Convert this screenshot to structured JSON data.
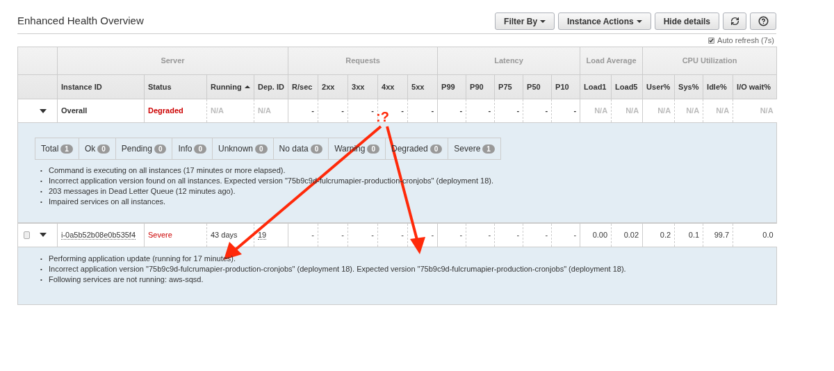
{
  "title": "Enhanced Health Overview",
  "buttons": [
    {
      "label": "Filter By",
      "kind": "dropdown"
    },
    {
      "label": "Instance Actions",
      "kind": "dropdown"
    },
    {
      "label": "Hide details",
      "kind": "plain"
    },
    {
      "kind": "refresh"
    },
    {
      "kind": "help"
    }
  ],
  "auto_refresh": {
    "label": "Auto refresh (7s)",
    "checked": true
  },
  "table": {
    "groups": [
      {
        "label": "Server",
        "columns": [
          {
            "label": "Instance ID",
            "sorted": false
          },
          {
            "label": "Status",
            "sorted": false
          },
          {
            "label": "Running",
            "sorted": true
          },
          {
            "label": "Dep. ID",
            "sorted": false
          }
        ]
      },
      {
        "label": "Requests",
        "columns": [
          {
            "label": "R/sec",
            "sorted": false
          },
          {
            "label": "2xx",
            "sorted": false
          },
          {
            "label": "3xx",
            "sorted": false
          },
          {
            "label": "4xx",
            "sorted": false
          },
          {
            "label": "5xx",
            "sorted": false
          }
        ]
      },
      {
        "label": "Latency",
        "columns": [
          {
            "label": "P99",
            "sorted": false
          },
          {
            "label": "P90",
            "sorted": false
          },
          {
            "label": "P75",
            "sorted": false
          },
          {
            "label": "P50",
            "sorted": false
          },
          {
            "label": "P10",
            "sorted": false
          }
        ]
      },
      {
        "label": "Load Average",
        "columns": [
          {
            "label": "Load1",
            "sorted": false
          },
          {
            "label": "Load5",
            "sorted": false
          }
        ]
      },
      {
        "label": "CPU Utilization",
        "columns": [
          {
            "label": "User%",
            "sorted": false
          },
          {
            "label": "Sys%",
            "sorted": false
          },
          {
            "label": "Idle%",
            "sorted": false
          },
          {
            "label": "I/O wait%",
            "sorted": false
          }
        ]
      }
    ],
    "rows": [
      {
        "kind": "summary",
        "expanded": true,
        "cells": [
          {
            "text": "Overall",
            "kind": "plain"
          },
          {
            "text": "Degraded",
            "kind": "status"
          },
          {
            "text": "N/A",
            "kind": "na"
          },
          {
            "text": "N/A",
            "kind": "na"
          },
          {
            "text": "-",
            "kind": "plain"
          },
          {
            "text": "-",
            "kind": "plain"
          },
          {
            "text": "-",
            "kind": "plain"
          },
          {
            "text": "-",
            "kind": "plain"
          },
          {
            "text": "-",
            "kind": "plain"
          },
          {
            "text": "-",
            "kind": "plain"
          },
          {
            "text": "-",
            "kind": "plain"
          },
          {
            "text": "-",
            "kind": "plain"
          },
          {
            "text": "-",
            "kind": "plain"
          },
          {
            "text": "-",
            "kind": "plain"
          },
          {
            "text": "N/A",
            "kind": "na"
          },
          {
            "text": "N/A",
            "kind": "na"
          },
          {
            "text": "N/A",
            "kind": "na"
          },
          {
            "text": "N/A",
            "kind": "na"
          },
          {
            "text": "N/A",
            "kind": "na"
          },
          {
            "text": "N/A",
            "kind": "na"
          }
        ],
        "badges": [
          {
            "label": "Total",
            "count": "1"
          },
          {
            "label": "Ok",
            "count": "0"
          },
          {
            "label": "Pending",
            "count": "0"
          },
          {
            "label": "Info",
            "count": "0"
          },
          {
            "label": "Unknown",
            "count": "0"
          },
          {
            "label": "No data",
            "count": "0"
          },
          {
            "label": "Warning",
            "count": "0"
          },
          {
            "label": "Degraded",
            "count": "0"
          },
          {
            "label": "Severe",
            "count": "1"
          }
        ],
        "messages": [
          {
            "bullet": "•",
            "text": "Command is executing on all instances (17 minutes or more elapsed)."
          },
          {
            "bullet": "•",
            "text": "Incorrect application version found on all instances. Expected version \"75b9c9d-fulcrumapier-production-cronjobs\" (deployment 18)."
          },
          {
            "bullet": "•",
            "text": "203 messages in Dead Letter Queue (12 minutes ago)."
          },
          {
            "bullet": "•",
            "text": "Impaired services on all instances."
          }
        ]
      },
      {
        "kind": "instance",
        "expanded": true,
        "checked": false,
        "cells": [
          {
            "text": "i-0a5b52b08e0b535f4",
            "kind": "link"
          },
          {
            "text": "Severe",
            "kind": "status"
          },
          {
            "text": "43 days",
            "kind": "plain"
          },
          {
            "text": "19",
            "kind": "link"
          },
          {
            "text": "-",
            "kind": "plain"
          },
          {
            "text": "-",
            "kind": "plain"
          },
          {
            "text": "-",
            "kind": "plain"
          },
          {
            "text": "-",
            "kind": "plain"
          },
          {
            "text": "-",
            "kind": "plain"
          },
          {
            "text": "-",
            "kind": "plain"
          },
          {
            "text": "-",
            "kind": "plain"
          },
          {
            "text": "-",
            "kind": "plain"
          },
          {
            "text": "-",
            "kind": "plain"
          },
          {
            "text": "-",
            "kind": "plain"
          },
          {
            "text": "0.00",
            "kind": "plain"
          },
          {
            "text": "0.02",
            "kind": "plain"
          },
          {
            "text": "0.2",
            "kind": "plain"
          },
          {
            "text": "0.1",
            "kind": "plain"
          },
          {
            "text": "99.7",
            "kind": "plain"
          },
          {
            "text": "0.0",
            "kind": "plain"
          }
        ],
        "messages": [
          {
            "bullet": "•",
            "text": "Performing application update (running for 17 minutes)."
          },
          {
            "bullet": "•",
            "text": "Incorrect application version \"75b9c9d-fulcrumapier-production-cronjobs\" (deployment 18). Expected version \"75b9c9d-fulcrumapier-production-cronjobs\" (deployment 18)."
          },
          {
            "bullet": "•",
            "text": "Following services are not running: aws-sqsd."
          }
        ]
      }
    ]
  },
  "annotation": {
    "text": ":?"
  }
}
